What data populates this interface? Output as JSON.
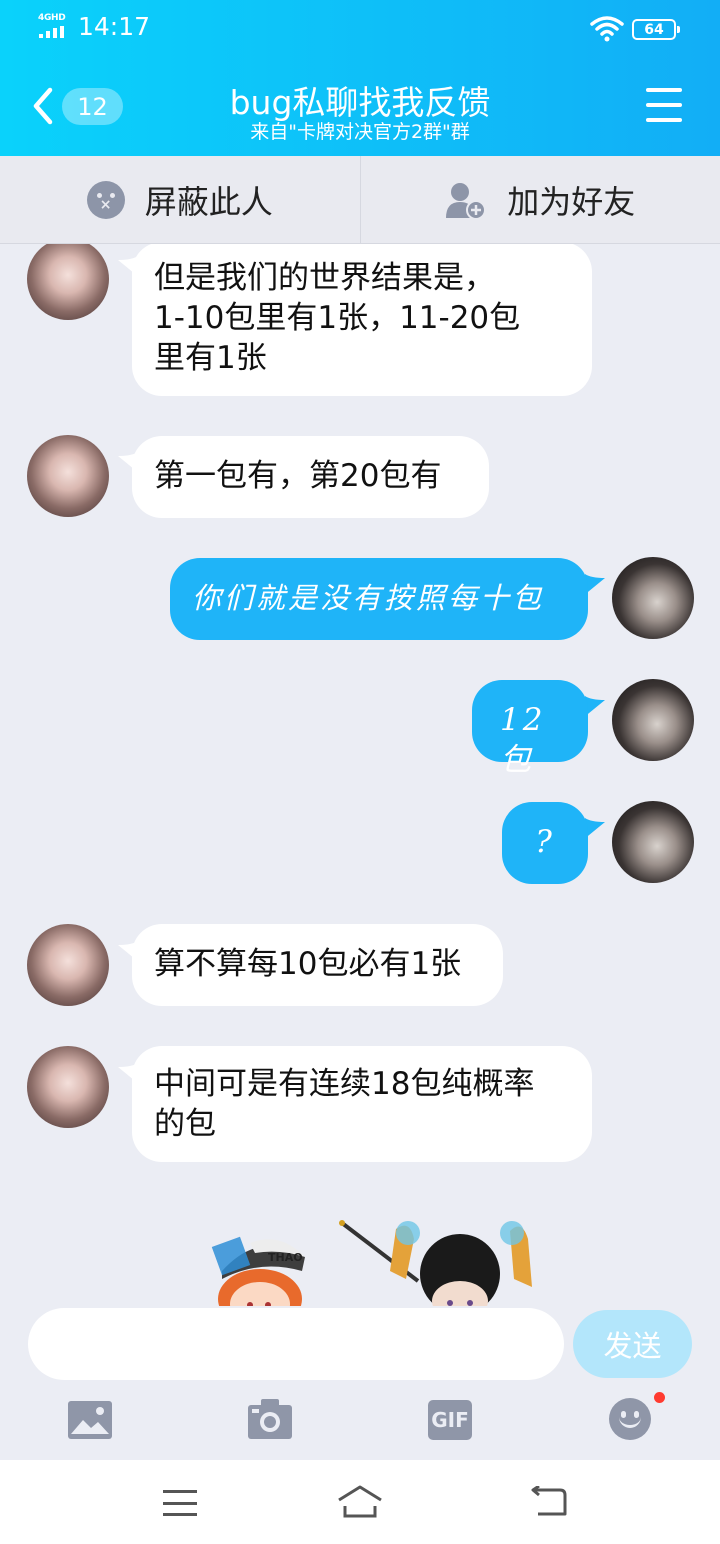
{
  "status_bar": {
    "network": "4GHD",
    "time": "14:17",
    "battery": "64"
  },
  "header": {
    "unread_count": "12",
    "title": "bug私聊找我反馈",
    "subtitle": "来自\"卡牌对决官方2群\"群"
  },
  "actions": {
    "block": "屏蔽此人",
    "add_friend": "加为好友"
  },
  "messages": [
    {
      "side": "left",
      "text": "但是我们的世界结果是，\n1-10包里有1张，11-20包\n里有1张"
    },
    {
      "side": "left",
      "text": "第一包有，第20包有"
    },
    {
      "side": "right",
      "text": "你们就是没有按照每十包"
    },
    {
      "side": "right",
      "text": "12包"
    },
    {
      "side": "right",
      "text": "?"
    },
    {
      "side": "left",
      "text": "算不算每10包必有1张"
    },
    {
      "side": "left",
      "text": "中间可是有连续18包纯概率\n的包"
    }
  ],
  "sticker_text": "THAO",
  "input": {
    "placeholder": "",
    "send_label": "发送"
  },
  "toolbar": {
    "gif_label": "GIF"
  },
  "colors": {
    "header_start": "#0ad2fb",
    "header_end": "#12aef6",
    "bubble_self": "#1fb4f8",
    "send_disabled": "#b3e6fb",
    "badge": "#ff3b30"
  }
}
